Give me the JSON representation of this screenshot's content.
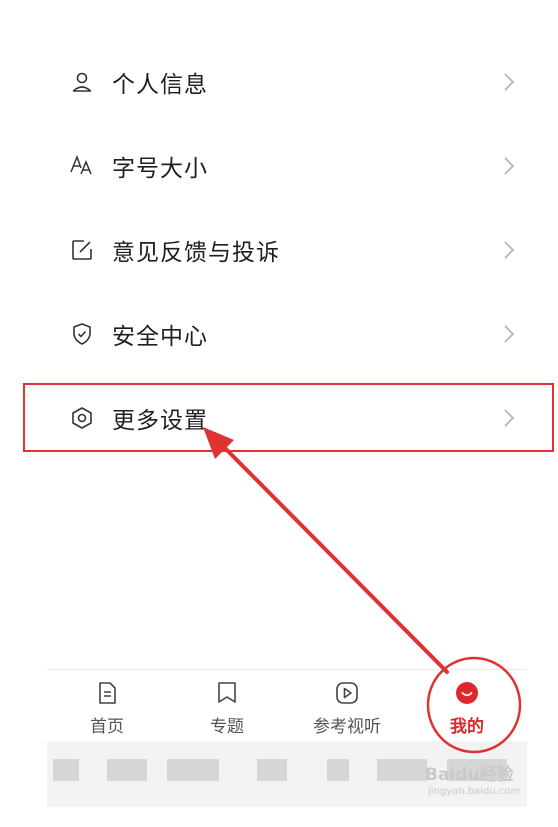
{
  "menu": {
    "items": [
      {
        "label": "个人信息",
        "icon": "user-icon"
      },
      {
        "label": "字号大小",
        "icon": "font-size-icon"
      },
      {
        "label": "意见反馈与投诉",
        "icon": "edit-icon"
      },
      {
        "label": "安全中心",
        "icon": "shield-icon"
      },
      {
        "label": "更多设置",
        "icon": "settings-icon"
      }
    ]
  },
  "tabbar": {
    "tabs": [
      {
        "label": "首页",
        "icon": "home-doc-icon"
      },
      {
        "label": "专题",
        "icon": "bookmark-icon"
      },
      {
        "label": "参考视听",
        "icon": "play-icon"
      },
      {
        "label": "我的",
        "icon": "mine-icon",
        "active": true
      }
    ]
  },
  "watermark": {
    "brand": "Baidu经验",
    "url": "jingyan.baidu.com"
  },
  "colors": {
    "accent": "#d92b2b",
    "annotation": "#e03232",
    "text": "#1f1f1f",
    "chevron": "#b5b5b5"
  }
}
